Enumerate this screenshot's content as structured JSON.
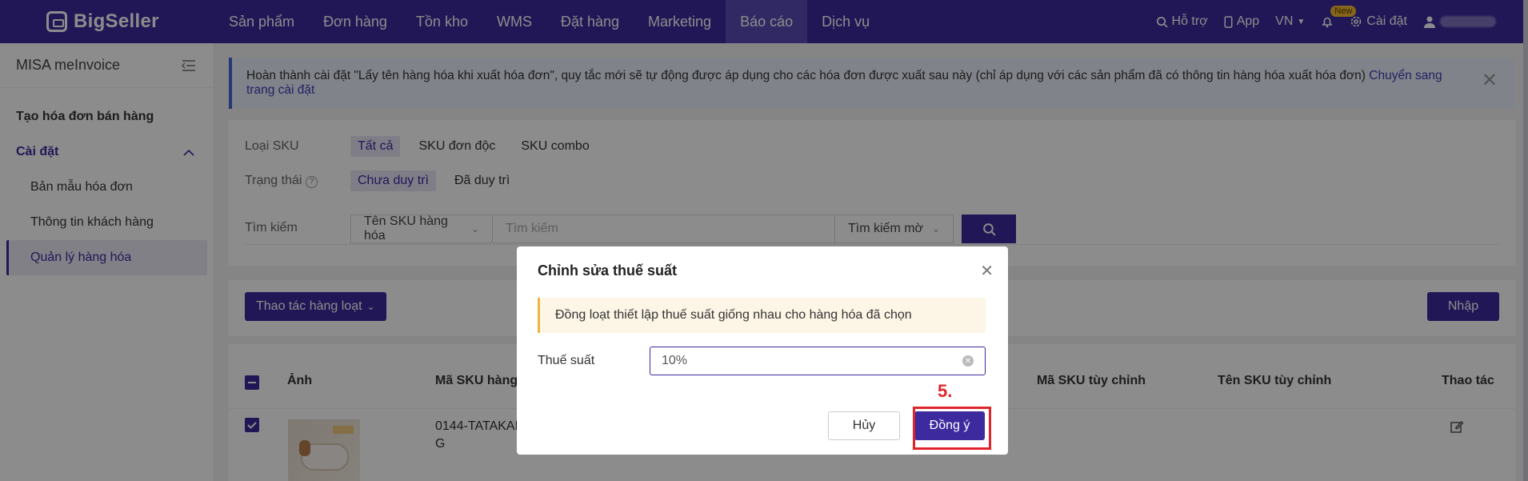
{
  "topbar": {
    "logo": "BigSeller",
    "nav": [
      "Sản phẩm",
      "Đơn hàng",
      "Tồn kho",
      "WMS",
      "Đặt hàng",
      "Marketing",
      "Báo cáo",
      "Dịch vụ"
    ],
    "support": "Hỗ trợ",
    "app": "App",
    "lang": "VN",
    "new_badge": "New",
    "settings": "Cài đặt"
  },
  "sidebar": {
    "title": "MISA meInvoice",
    "create": "Tạo hóa đơn bán hàng",
    "settings": "Cài đặt",
    "items": [
      "Bản mẫu hóa đơn",
      "Thông tin khách hàng",
      "Quản lý hàng hóa"
    ]
  },
  "alert": {
    "text": "Hoàn thành cài đặt \"Lấy tên hàng hóa khi xuất hóa đơn\", quy tắc mới sẽ tự động được áp dụng cho các hóa đơn được xuất sau này (chỉ áp dụng với các sản phẩm đã có thông tin hàng hóa xuất hóa đơn)",
    "link": "Chuyển sang trang cài đặt"
  },
  "filter": {
    "sku_type_label": "Loại SKU",
    "sku_types": [
      "Tất cả",
      "SKU đơn độc",
      "SKU combo"
    ],
    "status_label": "Trạng thái",
    "statuses": [
      "Chưa duy trì",
      "Đã duy trì"
    ],
    "search_label": "Tìm kiếm",
    "search_field": "Tên SKU hàng hóa",
    "search_placeholder": "Tìm kiếm",
    "search_mode": "Tìm kiếm mờ"
  },
  "toolbar": {
    "bulk": "Thao tác hàng loạt",
    "import": "Nhập"
  },
  "table": {
    "headers": [
      "Ảnh",
      "Mã SKU hàng h",
      "Mã SKU tùy chỉnh",
      "Tên SKU tùy chỉnh",
      "Thao tác"
    ],
    "row_sku_line1": "0144-TATAKAN",
    "row_sku_line2": "G"
  },
  "modal": {
    "title": "Chỉnh sửa thuế suất",
    "warning": "Đồng loạt thiết lập thuế suất giống nhau cho hàng hóa đã chọn",
    "tax_label": "Thuế suất",
    "tax_value": "10%",
    "cancel": "Hủy",
    "ok": "Đồng ý"
  },
  "annotation": {
    "step": "5."
  }
}
